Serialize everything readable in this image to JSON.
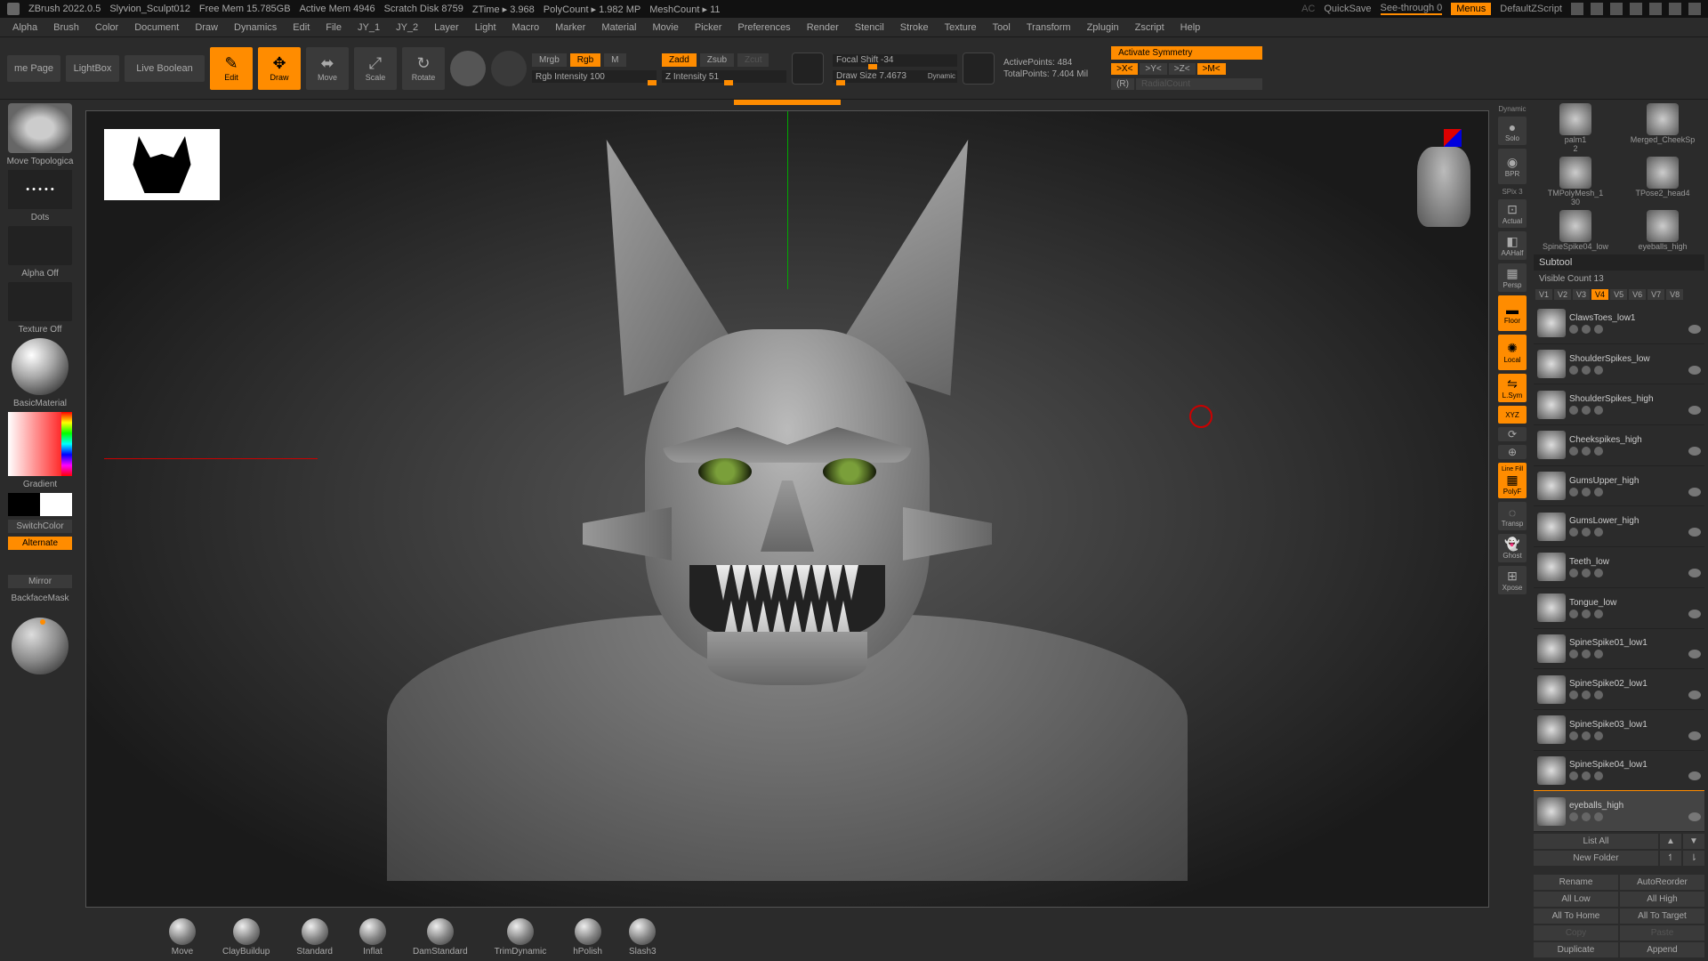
{
  "title": {
    "app": "ZBrush 2022.0.5",
    "doc": "Slyvion_Sculpt012",
    "stats": [
      "Free Mem 15.785GB",
      "Active Mem 4946",
      "Scratch Disk 8759",
      "ZTime ▸ 3.968",
      "PolyCount ▸ 1.982 MP",
      "MeshCount ▸ 11"
    ],
    "right": {
      "ac": "AC",
      "quicksave": "QuickSave",
      "seethrough": "See-through  0",
      "menus": "Menus",
      "zscript": "DefaultZScript"
    }
  },
  "menu": [
    "Alpha",
    "Brush",
    "Color",
    "Document",
    "Draw",
    "Dynamics",
    "Edit",
    "File",
    "JY_1",
    "JY_2",
    "Layer",
    "Light",
    "Macro",
    "Marker",
    "Material",
    "Movie",
    "Picker",
    "Preferences",
    "Render",
    "Stencil",
    "Stroke",
    "Texture",
    "Tool",
    "Transform",
    "Zplugin",
    "Zscript",
    "Help"
  ],
  "toolbar": {
    "home": "me Page",
    "lightbox": "LightBox",
    "liveboolean": "Live Boolean",
    "edit": "Edit",
    "draw": "Draw",
    "move": "Move",
    "scale": "Scale",
    "rotate": "Rotate",
    "mrgb": "Mrgb",
    "rgb": "Rgb",
    "m": "M",
    "rgb_intensity": "Rgb Intensity 100",
    "zadd": "Zadd",
    "zsub": "Zsub",
    "zcut": "Zcut",
    "z_intensity": "Z Intensity 51",
    "focal_shift": "Focal Shift -34",
    "draw_size": "Draw Size 7.4673",
    "dynamic": "Dynamic",
    "active_points": "ActivePoints: 484",
    "total_points": "TotalPoints: 7.404 Mil",
    "activate_sym": "Activate Symmetry",
    "sym": [
      ">X<",
      ">Y<",
      ">Z<",
      ">M<"
    ],
    "sym_r": "(R)",
    "radial": "RadialCount"
  },
  "left": {
    "brush": "Move Topologica",
    "stroke": "Dots",
    "alpha": "Alpha Off",
    "texture": "Texture Off",
    "material": "BasicMaterial",
    "gradient": "Gradient",
    "switchcolor": "SwitchColor",
    "alternate": "Alternate",
    "mirror": "Mirror",
    "backface": "BackfaceMask"
  },
  "right_buttons": {
    "dynamic": "Dynamic",
    "solo": "Solo",
    "bpr": "BPR",
    "spix": "SPix 3",
    "actual": "Actual",
    "aahalf": "AAHalf",
    "persp": "Persp",
    "floor": "Floor",
    "local": "Local",
    "lsym": "L.Sym",
    "xyz": "XYZ",
    "polyf": "PolyF",
    "transp": "Transp",
    "ghost": "Ghost",
    "xpose": "Xpose",
    "linefill": "Line Fill"
  },
  "top_thumbs": [
    {
      "name": "palm1",
      "extra": "2"
    },
    {
      "name": "Merged_CheekSp"
    },
    {
      "name": "TMPolyMesh_1",
      "extra": "30"
    },
    {
      "name": "TPose2_head4"
    },
    {
      "name": "SpineSpike04_low"
    },
    {
      "name": "eyeballs_high"
    }
  ],
  "subtool": {
    "header": "Subtool",
    "visible": "Visible Count 13",
    "vtabs": [
      "V1",
      "V2",
      "V3",
      "V4",
      "V5",
      "V6",
      "V7",
      "V8"
    ],
    "vactive": "V4",
    "items": [
      "ClawsToes_low1",
      "ShoulderSpikes_low",
      "ShoulderSpikes_high",
      "Cheekspikes_high",
      "GumsUpper_high",
      "GumsLower_high",
      "Teeth_low",
      "Tongue_low",
      "SpineSpike01_low1",
      "SpineSpike02_low1",
      "SpineSpike03_low1",
      "SpineSpike04_low1",
      "eyeballs_high"
    ],
    "active_idx": 12,
    "buttons": {
      "listall": "List All",
      "newfolder": "New Folder",
      "rename": "Rename",
      "autoreorder": "AutoReorder",
      "alllow": "All Low",
      "allhigh": "All High",
      "alltohome": "All To Home",
      "alltotarget": "All To Target",
      "copy": "Copy",
      "paste": "Paste",
      "duplicate": "Duplicate",
      "append": "Append"
    }
  },
  "tray": [
    "Move",
    "ClayBuildup",
    "Standard",
    "Inflat",
    "DamStandard",
    "TrimDynamic",
    "hPolish",
    "Slash3"
  ]
}
